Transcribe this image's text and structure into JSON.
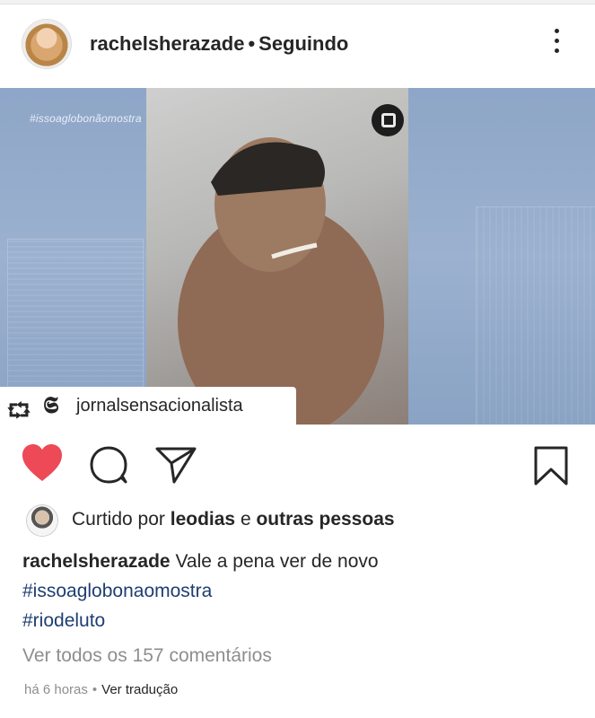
{
  "post": {
    "header": {
      "username": "rachelsherazade",
      "separator": "•",
      "follow_status": "Seguindo"
    },
    "media": {
      "overlay_hashtag": "#issoaglobonãomostra",
      "repost_username": "jornalsensacionalista"
    },
    "likes": {
      "prefix": "Curtido por",
      "liker": "leodias",
      "conjunction": "e",
      "others": "outras pessoas"
    },
    "caption": {
      "author": "rachelsherazade",
      "text": "Vale a pena ver de novo",
      "hashtags": [
        "#issoaglobonaomostra",
        "#riodeluto"
      ]
    },
    "view_comments": "Ver todos os 157 comentários",
    "timestamp": "há 6 horas",
    "meta_separator": "•",
    "translate_label": "Ver tradução"
  },
  "icons": {
    "more": "more-vertical-icon",
    "like": "heart-filled-icon",
    "comment": "comment-icon",
    "share": "send-icon",
    "save": "bookmark-icon",
    "repost": "repost-icon"
  },
  "colors": {
    "like_red": "#ed4956",
    "hashtag_blue": "#1e3e72",
    "muted_gray": "#8e8e8e"
  }
}
